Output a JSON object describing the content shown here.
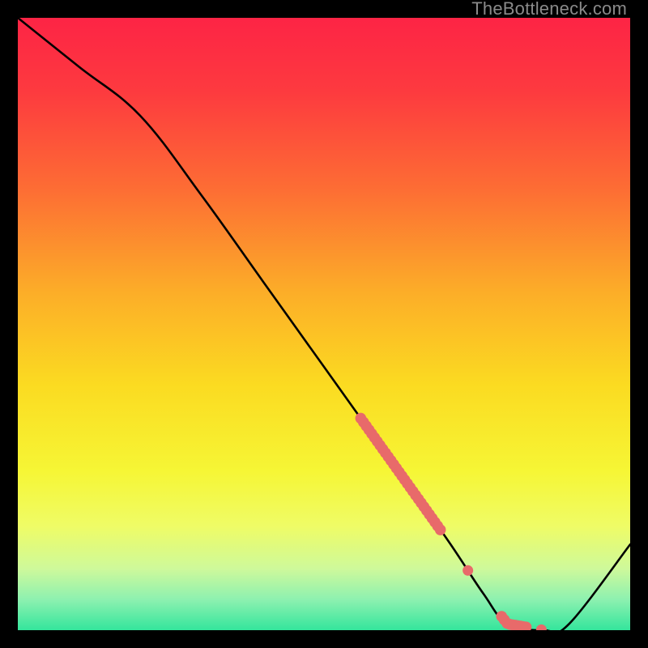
{
  "watermark": "TheBottleneck.com",
  "colors": {
    "frame": "#000000",
    "curve": "#000000",
    "marker": "#e86a6a",
    "gradient_stops": [
      {
        "offset": 0.0,
        "color": "#fd2445"
      },
      {
        "offset": 0.12,
        "color": "#fd3a3f"
      },
      {
        "offset": 0.28,
        "color": "#fd6d34"
      },
      {
        "offset": 0.45,
        "color": "#fcae28"
      },
      {
        "offset": 0.6,
        "color": "#fbdb21"
      },
      {
        "offset": 0.74,
        "color": "#f6f635"
      },
      {
        "offset": 0.83,
        "color": "#effc66"
      },
      {
        "offset": 0.9,
        "color": "#cef99b"
      },
      {
        "offset": 0.95,
        "color": "#8df1b0"
      },
      {
        "offset": 1.0,
        "color": "#34e59c"
      }
    ]
  },
  "chart_data": {
    "type": "line",
    "title": "",
    "xlabel": "",
    "ylabel": "",
    "xlim": [
      0,
      100
    ],
    "ylim": [
      0,
      100
    ],
    "categories": [
      0,
      10,
      20,
      30,
      40,
      50,
      60,
      70,
      76,
      80,
      86,
      90,
      100
    ],
    "series": [
      {
        "name": "bottleneck-curve",
        "x": [
          0,
          10,
          20,
          30,
          40,
          50,
          60,
          70,
          76,
          80,
          86,
          90,
          100
        ],
        "values": [
          100,
          92,
          84,
          71,
          57,
          43,
          29,
          15,
          6,
          1,
          0,
          1,
          14
        ]
      }
    ],
    "markers": [
      {
        "series": "bottleneck-curve",
        "x_start": 56,
        "x_end": 69,
        "style": "dense"
      },
      {
        "series": "bottleneck-curve",
        "x_start": 73,
        "x_end": 74,
        "style": "single"
      },
      {
        "series": "bottleneck-curve",
        "x_start": 79,
        "x_end": 83,
        "style": "dense"
      },
      {
        "series": "bottleneck-curve",
        "x_start": 85,
        "x_end": 86,
        "style": "single"
      }
    ]
  }
}
